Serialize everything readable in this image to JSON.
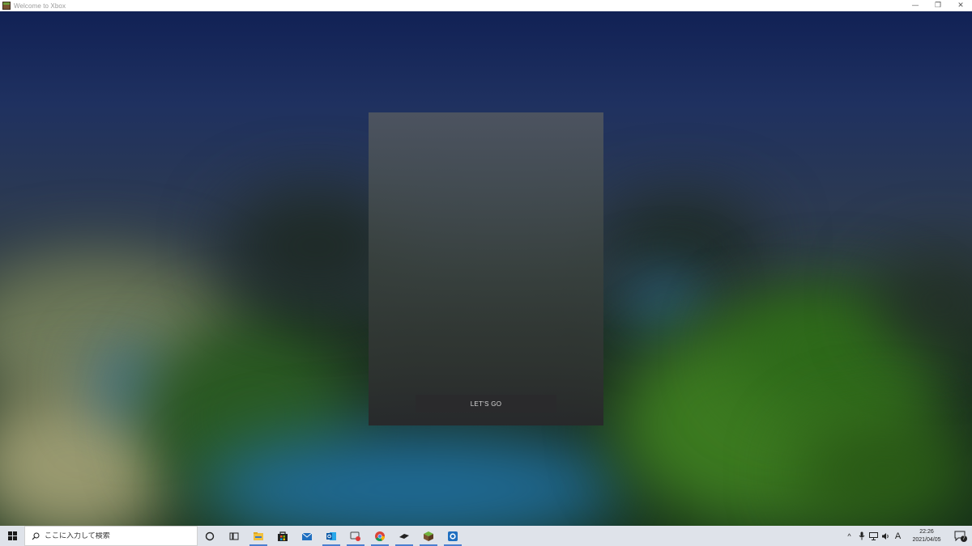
{
  "window": {
    "title": "Welcome to Xbox",
    "minimize_glyph": "—",
    "maximize_glyph": "❐",
    "close_glyph": "✕"
  },
  "dialog": {
    "primary_button_label": "LET'S GO"
  },
  "taskbar": {
    "search_placeholder": "ここに入力して検索",
    "pinned_apps": [
      {
        "name": "cortana-icon"
      },
      {
        "name": "task-view-icon"
      },
      {
        "name": "file-explorer-icon"
      },
      {
        "name": "store-icon"
      },
      {
        "name": "mail-icon"
      },
      {
        "name": "outlook-icon"
      },
      {
        "name": "game-bar-icon"
      },
      {
        "name": "chrome-icon"
      },
      {
        "name": "surface-icon"
      },
      {
        "name": "minecraft-icon"
      },
      {
        "name": "xbox-app-icon"
      }
    ],
    "tray": {
      "chevron": "^",
      "ime_label": "A",
      "time": "22:26",
      "date": "2021/04/05",
      "notification_count": "7"
    }
  },
  "colors": {
    "taskbar_bg": "#dfe3ea",
    "active_indicator": "#4a7fd0",
    "dialog_button_bg": "#2a2a2c"
  }
}
